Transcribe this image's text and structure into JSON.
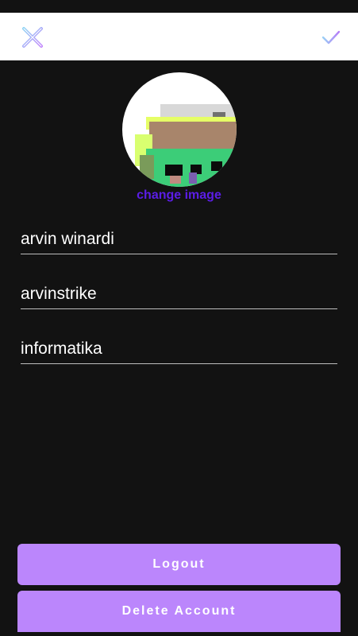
{
  "toolbar": {
    "close_icon": "close-x-icon",
    "confirm_icon": "checkmark-icon"
  },
  "profile": {
    "change_image_label": "change image",
    "name_value": "arvin winardi",
    "username_value": "arvinstrike",
    "major_value": "informatika"
  },
  "actions": {
    "logout_label": "Logout",
    "delete_label": "Delete Account"
  },
  "colors": {
    "background": "#121212",
    "toolbar": "#ffffff",
    "accent": "#bb86fc",
    "link": "#5b1de6"
  }
}
